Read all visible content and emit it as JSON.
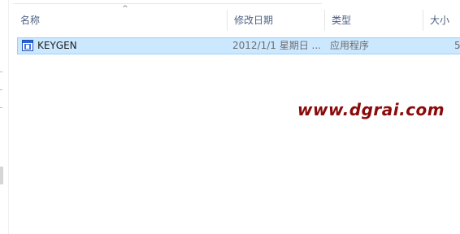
{
  "columns": {
    "name": "名称",
    "modified": "修改日期",
    "type": "类型",
    "size": "大小"
  },
  "sort_indicator": "^",
  "files": [
    {
      "name": "KEYGEN",
      "modified": "2012/1/1  星期日 ...",
      "type": "应用程序",
      "size": "5",
      "icon": "application-exe-icon",
      "selected": true
    }
  ],
  "watermark": "www.dgrai.com",
  "colors": {
    "selection_fill": "#cce8ff",
    "selection_border": "#99d1ff",
    "header_text": "#4d6082",
    "watermark": "#8b0a0a"
  }
}
